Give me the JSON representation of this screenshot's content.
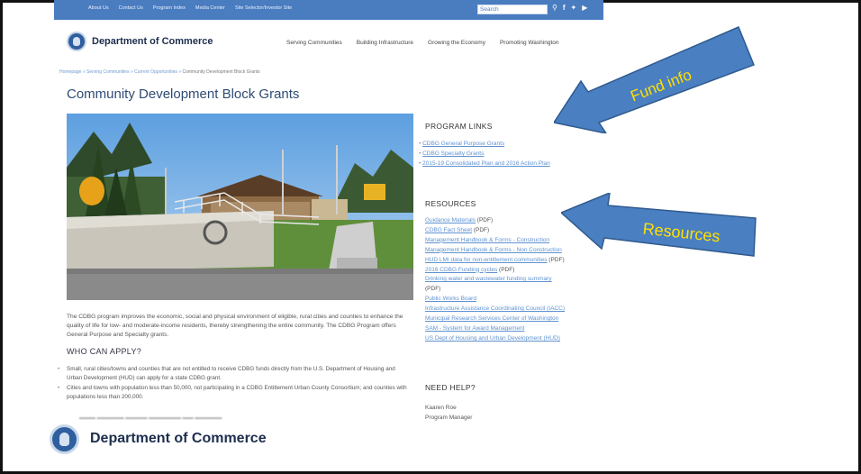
{
  "topnav": {
    "links": [
      "About Us",
      "Contact Us",
      "Program Index",
      "Media Center",
      "Site Selector/Investor Site"
    ],
    "search_placeholder": "Search",
    "icons": [
      "search-icon",
      "facebook-icon",
      "twitter-icon",
      "youtube-icon"
    ]
  },
  "header": {
    "logo_text": "Department of Commerce",
    "nav": [
      "Serving Communities",
      "Building Infrastructure",
      "Growing the Economy",
      "Promoting Washington"
    ]
  },
  "breadcrumb": {
    "links": [
      "Homepage",
      "Serving Communities",
      "Current Opportunities"
    ],
    "current": "Community Development Block Grants"
  },
  "main": {
    "title": "Community Development Block Grants",
    "intro": "The CDBG program improves the economic, social and physical environment of eligible, rural cities and counties to enhance the quality of life for low- and moderate-income residents, thereby strengthening the entire community. The CDBG Program offers General Purpose and Specialty grants.",
    "who_heading": "WHO CAN APPLY?",
    "bullets": [
      "Small, rural cities/towns and counties that are not entitled to receive CDBG funds directly from the U.S. Department of Housing and Urban Development (HUD) can apply for a state CDBG grant.",
      "Cities and towns with population less than 50,000, not participating in a CDBG Entitlement Urban County Consortium; and counties with populations less than 200,000."
    ]
  },
  "sidebar": {
    "program_links_heading": "PROGRAM LINKS",
    "program_links": [
      "CDBG General Purpose Grants",
      "CDBG Specialty Grants",
      "2015-19 Consolidated Plan and 2016 Action Plan"
    ],
    "resources_heading": "RESOURCES",
    "resources": [
      {
        "link": "Guidance Materials",
        "suffix": " (PDF)"
      },
      {
        "link": "CDBG Fact Sheet",
        "suffix": " (PDF)"
      },
      {
        "link": "Management Handbook & Forms - Construction",
        "suffix": ""
      },
      {
        "link": "Management Handbook & Forms - Non Construction",
        "suffix": ""
      },
      {
        "link": "HUD LMI data for non-entitlement communities",
        "suffix": " (PDF)"
      },
      {
        "link": "2016 CDBG Funding cycles",
        "suffix": " (PDF)"
      },
      {
        "link": "Drinking water and wastewater funding summary",
        "suffix": ""
      },
      {
        "link": "",
        "suffix": "(PDF)"
      },
      {
        "link": "Public Works Board",
        "suffix": ""
      },
      {
        "link": "Infrastructure Assistance Coordinating Council (IACC)",
        "suffix": ""
      },
      {
        "link": "Municipal Research Services Center of Washington",
        "suffix": ""
      },
      {
        "link": "SAM - System for Award Management",
        "suffix": ""
      },
      {
        "link": "US Dept of Housing and Urban Development (HUD)",
        "suffix": ""
      }
    ],
    "help_heading": "NEED HELP?",
    "help_name": "Kaaren Roe",
    "help_role": "Program Manager"
  },
  "annotations": {
    "fund_info": "Fund info",
    "resources": "Resources",
    "arrow_color": "#4a7fc1"
  },
  "footer": {
    "logo_text": "Department of Commerce"
  }
}
